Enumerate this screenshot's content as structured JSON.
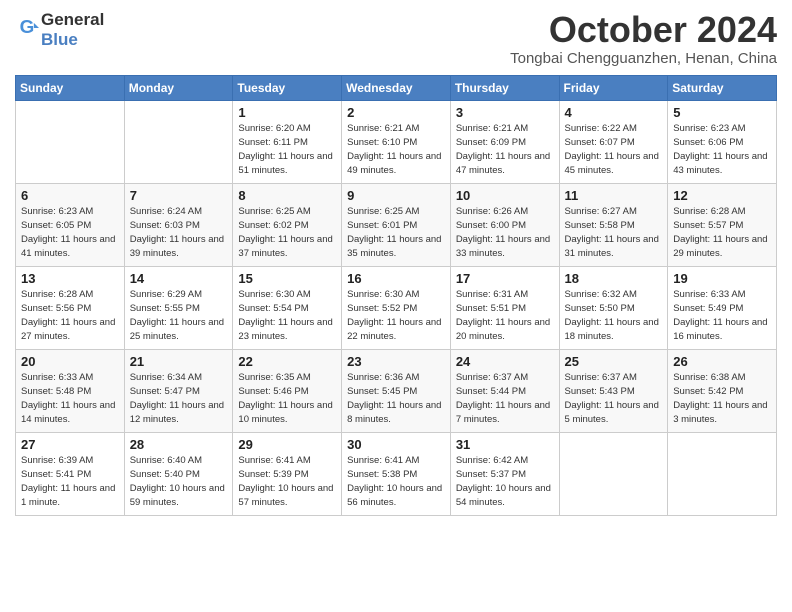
{
  "header": {
    "logo_general": "General",
    "logo_blue": "Blue",
    "month_title": "October 2024",
    "location": "Tongbai Chengguanzhen, Henan, China"
  },
  "days_of_week": [
    "Sunday",
    "Monday",
    "Tuesday",
    "Wednesday",
    "Thursday",
    "Friday",
    "Saturday"
  ],
  "weeks": [
    [
      {
        "day": "",
        "sunrise": "",
        "sunset": "",
        "daylight": ""
      },
      {
        "day": "",
        "sunrise": "",
        "sunset": "",
        "daylight": ""
      },
      {
        "day": "1",
        "sunrise": "Sunrise: 6:20 AM",
        "sunset": "Sunset: 6:11 PM",
        "daylight": "Daylight: 11 hours and 51 minutes."
      },
      {
        "day": "2",
        "sunrise": "Sunrise: 6:21 AM",
        "sunset": "Sunset: 6:10 PM",
        "daylight": "Daylight: 11 hours and 49 minutes."
      },
      {
        "day": "3",
        "sunrise": "Sunrise: 6:21 AM",
        "sunset": "Sunset: 6:09 PM",
        "daylight": "Daylight: 11 hours and 47 minutes."
      },
      {
        "day": "4",
        "sunrise": "Sunrise: 6:22 AM",
        "sunset": "Sunset: 6:07 PM",
        "daylight": "Daylight: 11 hours and 45 minutes."
      },
      {
        "day": "5",
        "sunrise": "Sunrise: 6:23 AM",
        "sunset": "Sunset: 6:06 PM",
        "daylight": "Daylight: 11 hours and 43 minutes."
      }
    ],
    [
      {
        "day": "6",
        "sunrise": "Sunrise: 6:23 AM",
        "sunset": "Sunset: 6:05 PM",
        "daylight": "Daylight: 11 hours and 41 minutes."
      },
      {
        "day": "7",
        "sunrise": "Sunrise: 6:24 AM",
        "sunset": "Sunset: 6:03 PM",
        "daylight": "Daylight: 11 hours and 39 minutes."
      },
      {
        "day": "8",
        "sunrise": "Sunrise: 6:25 AM",
        "sunset": "Sunset: 6:02 PM",
        "daylight": "Daylight: 11 hours and 37 minutes."
      },
      {
        "day": "9",
        "sunrise": "Sunrise: 6:25 AM",
        "sunset": "Sunset: 6:01 PM",
        "daylight": "Daylight: 11 hours and 35 minutes."
      },
      {
        "day": "10",
        "sunrise": "Sunrise: 6:26 AM",
        "sunset": "Sunset: 6:00 PM",
        "daylight": "Daylight: 11 hours and 33 minutes."
      },
      {
        "day": "11",
        "sunrise": "Sunrise: 6:27 AM",
        "sunset": "Sunset: 5:58 PM",
        "daylight": "Daylight: 11 hours and 31 minutes."
      },
      {
        "day": "12",
        "sunrise": "Sunrise: 6:28 AM",
        "sunset": "Sunset: 5:57 PM",
        "daylight": "Daylight: 11 hours and 29 minutes."
      }
    ],
    [
      {
        "day": "13",
        "sunrise": "Sunrise: 6:28 AM",
        "sunset": "Sunset: 5:56 PM",
        "daylight": "Daylight: 11 hours and 27 minutes."
      },
      {
        "day": "14",
        "sunrise": "Sunrise: 6:29 AM",
        "sunset": "Sunset: 5:55 PM",
        "daylight": "Daylight: 11 hours and 25 minutes."
      },
      {
        "day": "15",
        "sunrise": "Sunrise: 6:30 AM",
        "sunset": "Sunset: 5:54 PM",
        "daylight": "Daylight: 11 hours and 23 minutes."
      },
      {
        "day": "16",
        "sunrise": "Sunrise: 6:30 AM",
        "sunset": "Sunset: 5:52 PM",
        "daylight": "Daylight: 11 hours and 22 minutes."
      },
      {
        "day": "17",
        "sunrise": "Sunrise: 6:31 AM",
        "sunset": "Sunset: 5:51 PM",
        "daylight": "Daylight: 11 hours and 20 minutes."
      },
      {
        "day": "18",
        "sunrise": "Sunrise: 6:32 AM",
        "sunset": "Sunset: 5:50 PM",
        "daylight": "Daylight: 11 hours and 18 minutes."
      },
      {
        "day": "19",
        "sunrise": "Sunrise: 6:33 AM",
        "sunset": "Sunset: 5:49 PM",
        "daylight": "Daylight: 11 hours and 16 minutes."
      }
    ],
    [
      {
        "day": "20",
        "sunrise": "Sunrise: 6:33 AM",
        "sunset": "Sunset: 5:48 PM",
        "daylight": "Daylight: 11 hours and 14 minutes."
      },
      {
        "day": "21",
        "sunrise": "Sunrise: 6:34 AM",
        "sunset": "Sunset: 5:47 PM",
        "daylight": "Daylight: 11 hours and 12 minutes."
      },
      {
        "day": "22",
        "sunrise": "Sunrise: 6:35 AM",
        "sunset": "Sunset: 5:46 PM",
        "daylight": "Daylight: 11 hours and 10 minutes."
      },
      {
        "day": "23",
        "sunrise": "Sunrise: 6:36 AM",
        "sunset": "Sunset: 5:45 PM",
        "daylight": "Daylight: 11 hours and 8 minutes."
      },
      {
        "day": "24",
        "sunrise": "Sunrise: 6:37 AM",
        "sunset": "Sunset: 5:44 PM",
        "daylight": "Daylight: 11 hours and 7 minutes."
      },
      {
        "day": "25",
        "sunrise": "Sunrise: 6:37 AM",
        "sunset": "Sunset: 5:43 PM",
        "daylight": "Daylight: 11 hours and 5 minutes."
      },
      {
        "day": "26",
        "sunrise": "Sunrise: 6:38 AM",
        "sunset": "Sunset: 5:42 PM",
        "daylight": "Daylight: 11 hours and 3 minutes."
      }
    ],
    [
      {
        "day": "27",
        "sunrise": "Sunrise: 6:39 AM",
        "sunset": "Sunset: 5:41 PM",
        "daylight": "Daylight: 11 hours and 1 minute."
      },
      {
        "day": "28",
        "sunrise": "Sunrise: 6:40 AM",
        "sunset": "Sunset: 5:40 PM",
        "daylight": "Daylight: 10 hours and 59 minutes."
      },
      {
        "day": "29",
        "sunrise": "Sunrise: 6:41 AM",
        "sunset": "Sunset: 5:39 PM",
        "daylight": "Daylight: 10 hours and 57 minutes."
      },
      {
        "day": "30",
        "sunrise": "Sunrise: 6:41 AM",
        "sunset": "Sunset: 5:38 PM",
        "daylight": "Daylight: 10 hours and 56 minutes."
      },
      {
        "day": "31",
        "sunrise": "Sunrise: 6:42 AM",
        "sunset": "Sunset: 5:37 PM",
        "daylight": "Daylight: 10 hours and 54 minutes."
      },
      {
        "day": "",
        "sunrise": "",
        "sunset": "",
        "daylight": ""
      },
      {
        "day": "",
        "sunrise": "",
        "sunset": "",
        "daylight": ""
      }
    ]
  ]
}
